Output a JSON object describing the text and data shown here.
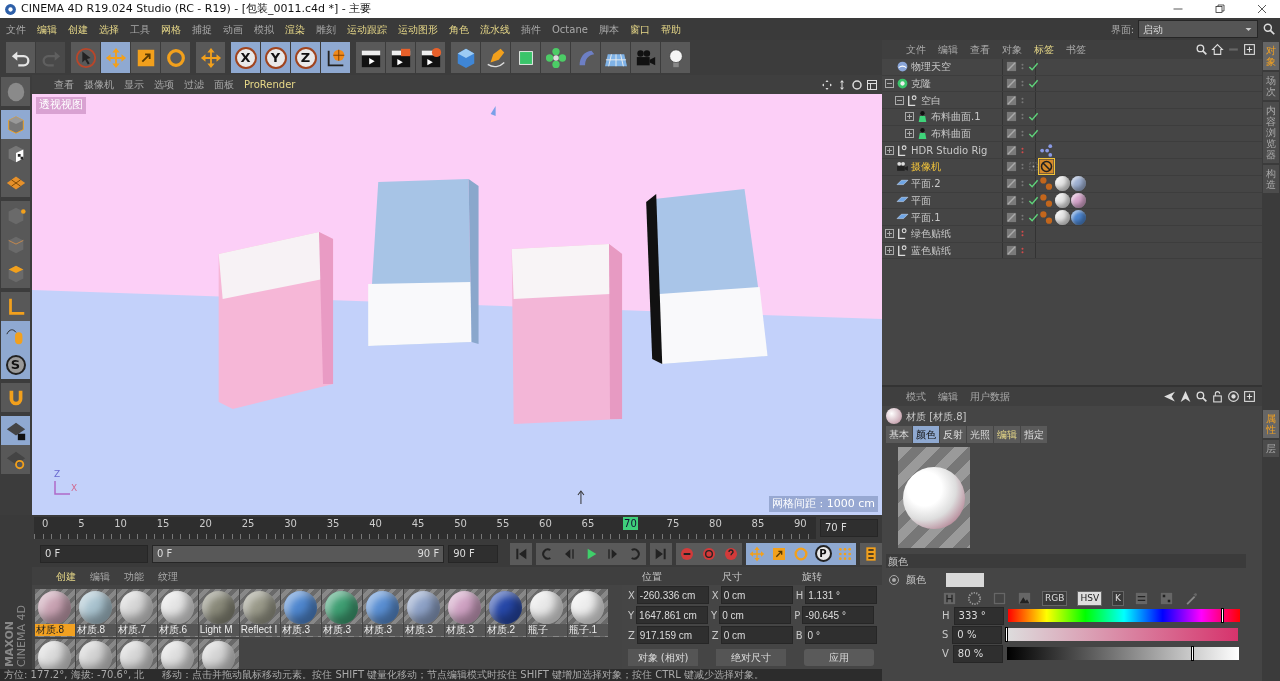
{
  "window": {
    "title": "CINEMA 4D R19.024 Studio (RC - R19) - [包装_0011.c4d *] - 主要"
  },
  "menu": [
    {
      "label": "文件",
      "highlighted": false
    },
    {
      "label": "编辑",
      "highlighted": true
    },
    {
      "label": "创建",
      "highlighted": true
    },
    {
      "label": "选择",
      "highlighted": true
    },
    {
      "label": "工具",
      "highlighted": false
    },
    {
      "label": "网格",
      "highlighted": true
    },
    {
      "label": "捕捉",
      "highlighted": false
    },
    {
      "label": "动画",
      "highlighted": false
    },
    {
      "label": "模拟",
      "highlighted": false
    },
    {
      "label": "渲染",
      "highlighted": true
    },
    {
      "label": "雕刻",
      "highlighted": false
    },
    {
      "label": "运动跟踪",
      "highlighted": true
    },
    {
      "label": "运动图形",
      "highlighted": true
    },
    {
      "label": "角色",
      "highlighted": true
    },
    {
      "label": "流水线",
      "highlighted": true
    },
    {
      "label": "插件",
      "highlighted": false
    },
    {
      "label": "Octane",
      "highlighted": false
    },
    {
      "label": "脚本",
      "highlighted": false
    },
    {
      "label": "窗口",
      "highlighted": true
    },
    {
      "label": "帮助",
      "highlighted": true
    }
  ],
  "layout": {
    "label": "界面:",
    "value": "启动"
  },
  "toolbar": [
    [
      {
        "kind": "undo",
        "selected": false,
        "disabled": false
      },
      {
        "kind": "redo",
        "selected": false,
        "disabled": true
      }
    ],
    [
      {
        "kind": "cursor",
        "selected": false,
        "disabled": false
      },
      {
        "kind": "move",
        "selected": true,
        "disabled": false
      },
      {
        "kind": "scale",
        "selected": false,
        "disabled": false
      },
      {
        "kind": "rotate",
        "selected": false,
        "disabled": false
      }
    ],
    [
      {
        "kind": "move",
        "selected": false,
        "disabled": false
      }
    ],
    [
      {
        "kind": "axis",
        "label": "X",
        "selected": true,
        "disabled": false
      },
      {
        "kind": "axis",
        "label": "Y",
        "selected": true,
        "disabled": false
      },
      {
        "kind": "axis",
        "label": "Z",
        "selected": true,
        "disabled": false
      },
      {
        "kind": "world",
        "selected": true,
        "disabled": false
      }
    ],
    [
      {
        "kind": "clapper",
        "selected": false,
        "disabled": false
      },
      {
        "kind": "render-picture",
        "selected": false,
        "disabled": false
      },
      {
        "kind": "render-settings",
        "selected": false,
        "disabled": false
      }
    ],
    [
      {
        "kind": "cube",
        "selected": false,
        "disabled": false
      },
      {
        "kind": "pen",
        "selected": false,
        "disabled": false
      },
      {
        "kind": "subdivision",
        "selected": false,
        "disabled": false
      },
      {
        "kind": "cloner",
        "selected": false,
        "disabled": false
      },
      {
        "kind": "bend",
        "selected": false,
        "disabled": false
      },
      {
        "kind": "floor",
        "selected": false,
        "disabled": false
      },
      {
        "kind": "camera",
        "selected": false,
        "disabled": false
      },
      {
        "kind": "light",
        "selected": false,
        "disabled": false
      }
    ]
  ],
  "left_tools": [
    [
      {
        "kind": "sculpt",
        "selected": false
      }
    ],
    [
      {
        "kind": "model",
        "selected": true
      },
      {
        "kind": "texture",
        "selected": false
      },
      {
        "kind": "workplane",
        "selected": false
      }
    ],
    [
      {
        "kind": "points",
        "selected": false
      },
      {
        "kind": "edges",
        "selected": false
      },
      {
        "kind": "polygons",
        "selected": false
      }
    ],
    [
      {
        "kind": "axis-l",
        "selected": false
      },
      {
        "kind": "tweak",
        "selected": true
      },
      {
        "kind": "solo",
        "label": "S",
        "selected": true
      }
    ],
    [
      {
        "kind": "magnet",
        "selected": false
      }
    ],
    [
      {
        "kind": "lock-grid",
        "selected": true
      },
      {
        "kind": "grid-cycle",
        "selected": false
      }
    ]
  ],
  "viewport": {
    "menu": [
      {
        "label": "查看",
        "highlighted": false
      },
      {
        "label": "摄像机",
        "highlighted": false
      },
      {
        "label": "显示",
        "highlighted": false
      },
      {
        "label": "选项",
        "highlighted": false
      },
      {
        "label": "过滤",
        "highlighted": false
      },
      {
        "label": "面板",
        "highlighted": false
      },
      {
        "label": "ProRender",
        "highlighted": true
      }
    ],
    "label": "透视视图",
    "grid_label": "网格间距 : 1000 cm",
    "axes": [
      "Z",
      "X"
    ]
  },
  "timeline": {
    "ticks": [
      {
        "label": "0",
        "selected": false
      },
      {
        "label": "5",
        "selected": false
      },
      {
        "label": "10",
        "selected": false
      },
      {
        "label": "15",
        "selected": false
      },
      {
        "label": "20",
        "selected": false
      },
      {
        "label": "25",
        "selected": false
      },
      {
        "label": "30",
        "selected": false
      },
      {
        "label": "35",
        "selected": false
      },
      {
        "label": "40",
        "selected": false
      },
      {
        "label": "45",
        "selected": false
      },
      {
        "label": "50",
        "selected": false
      },
      {
        "label": "55",
        "selected": false
      },
      {
        "label": "60",
        "selected": false
      },
      {
        "label": "65",
        "selected": false
      },
      {
        "label": "70",
        "selected": true
      },
      {
        "label": "75",
        "selected": false
      },
      {
        "label": "80",
        "selected": false
      },
      {
        "label": "85",
        "selected": false
      },
      {
        "label": "90",
        "selected": false
      }
    ],
    "frame": "70 F",
    "start": "0 F",
    "range_start": "0 F",
    "range_end": "90 F",
    "end": "90 F",
    "mode_label": "P"
  },
  "materials": {
    "tabs": [
      {
        "label": "创建",
        "selected": true
      },
      {
        "label": "编辑",
        "selected": false
      },
      {
        "label": "功能",
        "selected": false
      },
      {
        "label": "纹理",
        "selected": false
      }
    ],
    "items": [
      {
        "name": "材质.8",
        "color": "#c9a3b3",
        "selected": true
      },
      {
        "name": "材质.8",
        "color": "#a9c3cf",
        "selected": false
      },
      {
        "name": "材质.7",
        "color": "#d6d6d6",
        "selected": false
      },
      {
        "name": "材质.6",
        "color": "#e4e4e4",
        "selected": false
      },
      {
        "name": "Light M",
        "color": "#8a8a7a",
        "selected": false
      },
      {
        "name": "Reflect I",
        "color": "#9a9a8a",
        "selected": false
      },
      {
        "name": "材质.3",
        "color": "#4f87cf",
        "selected": false
      },
      {
        "name": "材质.3",
        "color": "#3f9f73",
        "selected": false
      },
      {
        "name": "材质.3",
        "color": "#5a8fd3",
        "selected": false
      },
      {
        "name": "材质.3",
        "color": "#8ea2c7",
        "selected": false
      },
      {
        "name": "材质.3",
        "color": "#cfa2c3",
        "selected": false
      },
      {
        "name": "材质.2",
        "color": "#2748a8",
        "selected": false
      },
      {
        "name": "瓶子",
        "color": "#e8e8e8",
        "selected": false
      },
      {
        "name": "瓶子.1",
        "color": "#ededed",
        "selected": false
      }
    ],
    "row2": [
      {
        "color": "#dadada"
      },
      {
        "color": "#d2d2d2"
      },
      {
        "color": "#d6d6d6"
      },
      {
        "color": "#dedede"
      },
      {
        "color": "#d4d4d4"
      }
    ]
  },
  "coords": {
    "headers": [
      "位置",
      "尺寸",
      "旋转"
    ],
    "rows": [
      [
        {
          "axis": "X",
          "value": "-260.336 cm"
        },
        {
          "axis": "X",
          "value": "0 cm"
        },
        {
          "axis": "H",
          "value": "1.131 °"
        }
      ],
      [
        {
          "axis": "Y",
          "value": "1647.861 cm"
        },
        {
          "axis": "Y",
          "value": "0 cm"
        },
        {
          "axis": "P",
          "value": "-90.645 °"
        }
      ],
      [
        {
          "axis": "Z",
          "value": "917.159 cm"
        },
        {
          "axis": "Z",
          "value": "0 cm"
        },
        {
          "axis": "B",
          "value": "0 °"
        }
      ]
    ],
    "dropdowns": [
      "对象 (相对)",
      "绝对尺寸"
    ],
    "apply": "应用"
  },
  "status": {
    "orientation": "方位: 177.2°, 海拔: -70.6°, 北",
    "hint": "移动：点击并拖动鼠标移动元素。按住 SHIFT 键量化移动；节点编辑模式时按住 SHIFT 键增加选择对象；按住 CTRL 键减少选择对象。"
  },
  "logo": {
    "brand": "MAXON",
    "product": "CINEMA 4D"
  },
  "objects": {
    "menu": [
      {
        "label": "文件",
        "highlighted": false
      },
      {
        "label": "编辑",
        "highlighted": false
      },
      {
        "label": "查看",
        "highlighted": false
      },
      {
        "label": "对象",
        "highlighted": false
      },
      {
        "label": "标签",
        "highlighted": true
      },
      {
        "label": "书签",
        "highlighted": false
      }
    ],
    "tree": [
      {
        "name": "物理天空",
        "kind": "sky",
        "visible": true,
        "active": false
      },
      {
        "name": "克隆",
        "kind": "cloner",
        "expanded": true,
        "visible": true,
        "active": false,
        "children": [
          {
            "name": "空白",
            "kind": "null",
            "expanded": true,
            "active": false,
            "children": [
              {
                "name": "布料曲面.1",
                "kind": "cloth",
                "expanded": false,
                "visible": true,
                "active": false
              },
              {
                "name": "布料曲面",
                "kind": "cloth",
                "expanded": false,
                "visible": true,
                "active": false
              }
            ]
          }
        ]
      },
      {
        "name": "HDR Studio Rig",
        "kind": "null",
        "expanded": false,
        "visible": false,
        "active": false,
        "tags": [
          {
            "kind": "xpresso",
            "selected": false
          }
        ]
      },
      {
        "name": "摄像机",
        "kind": "camera",
        "active": true,
        "tags": [
          {
            "kind": "protection",
            "selected": true
          }
        ]
      },
      {
        "name": "平面.2",
        "kind": "plane",
        "visible": true,
        "active": false,
        "tags": [
          {
            "kind": "phong",
            "selected": false
          },
          {
            "kind": "material",
            "color": "#e6e6e6",
            "selected": false
          },
          {
            "kind": "material",
            "color": "#9fb1d3",
            "selected": false
          }
        ]
      },
      {
        "name": "平面",
        "kind": "plane",
        "visible": true,
        "active": false,
        "tags": [
          {
            "kind": "phong",
            "selected": false
          },
          {
            "kind": "material",
            "color": "#e6e6e6",
            "selected": false
          },
          {
            "kind": "material",
            "color": "#d7a6cc",
            "selected": false
          }
        ]
      },
      {
        "name": "平面.1",
        "kind": "plane",
        "visible": true,
        "active": false,
        "tags": [
          {
            "kind": "phong",
            "selected": false
          },
          {
            "kind": "material",
            "color": "#e6e6e6",
            "selected": false
          },
          {
            "kind": "material",
            "color": "#4d86d0",
            "selected": false
          }
        ]
      },
      {
        "name": "绿色贴纸",
        "kind": "null",
        "expanded": false,
        "visible": false,
        "active": false
      },
      {
        "name": "蓝色贴纸",
        "kind": "null",
        "expanded": false,
        "visible": false,
        "active": false
      }
    ],
    "side_tabs": [
      {
        "label": "对象",
        "selected": true
      },
      {
        "label": "场次",
        "selected": false
      },
      {
        "label": "内容浏览器",
        "selected": false
      },
      {
        "label": "构造",
        "selected": false
      }
    ]
  },
  "attributes": {
    "menu": [
      "模式",
      "编辑",
      "用户数据"
    ],
    "title": "材质 [材质.8]",
    "tabs": [
      {
        "label": "基本",
        "selected": false,
        "highlighted": false
      },
      {
        "label": "颜色",
        "selected": true,
        "highlighted": false
      },
      {
        "label": "反射",
        "selected": false,
        "highlighted": false
      },
      {
        "label": "光照",
        "selected": false,
        "highlighted": false
      },
      {
        "label": "编辑",
        "selected": false,
        "highlighted": true
      },
      {
        "label": "指定",
        "selected": false,
        "highlighted": false
      }
    ],
    "section": "颜色",
    "color_label": "颜色",
    "color": "#d9d9d9",
    "modes": [
      {
        "label": "RGB",
        "selected": false
      },
      {
        "label": "HSV",
        "selected": true
      },
      {
        "label": "K",
        "selected": false
      }
    ],
    "channels": [
      {
        "name": "H",
        "value": "333 °",
        "kind": "hue",
        "level": 0.925
      },
      {
        "name": "S",
        "value": "0 %",
        "kind": "saturation",
        "level": 0
      },
      {
        "name": "V",
        "value": "80 %",
        "kind": "value",
        "level": 0.8
      }
    ],
    "side_tabs": [
      {
        "label": "属性",
        "selected": true
      },
      {
        "label": "层",
        "selected": false
      }
    ]
  }
}
